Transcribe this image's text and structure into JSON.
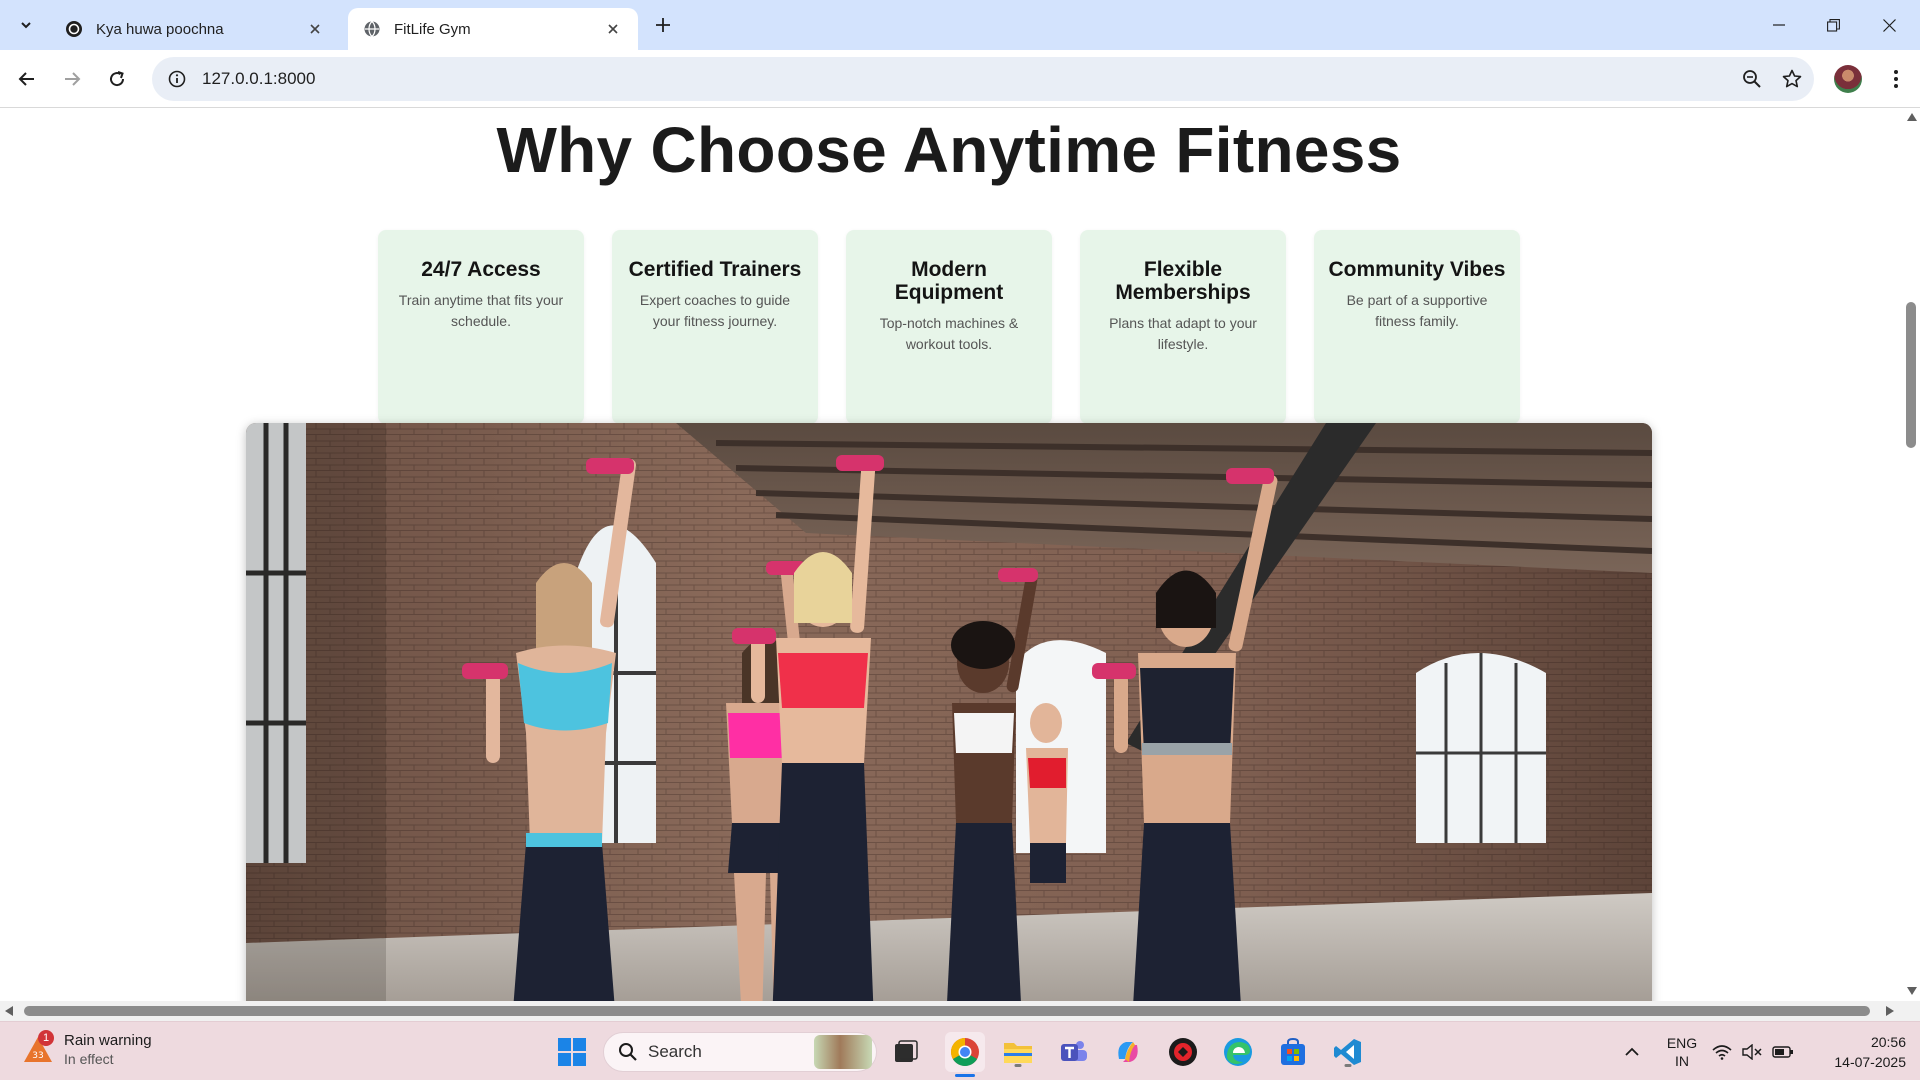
{
  "browser": {
    "tabs": [
      {
        "title": "Kya huwa poochna",
        "active": false,
        "icon": "chatgpt-icon"
      },
      {
        "title": "FitLife Gym",
        "active": true,
        "icon": "globe-icon"
      }
    ],
    "url": "127.0.0.1:8000"
  },
  "page": {
    "headline": "Why Choose Anytime Fitness",
    "features": [
      {
        "title": "24/7 Access",
        "desc": "Train anytime that fits your schedule."
      },
      {
        "title": "Certified Trainers",
        "desc": "Expert coaches to guide your fitness journey."
      },
      {
        "title": "Modern Equipment",
        "desc": "Top-notch machines & workout tools."
      },
      {
        "title": "Flexible Memberships",
        "desc": "Plans that adapt to your lifestyle."
      },
      {
        "title": "Community Vibes",
        "desc": "Be part of a supportive fitness family."
      }
    ]
  },
  "taskbar": {
    "weather": {
      "title": "Rain warning",
      "subtitle": "In effect",
      "badge": "1"
    },
    "search_placeholder": "Search",
    "language": {
      "line1": "ENG",
      "line2": "IN"
    },
    "time": "20:56",
    "date": "14-07-2025"
  },
  "colors": {
    "tabbar": "#d3e3fd",
    "card": "#e7f5e9",
    "taskbar": "#eedadf",
    "accent": "#1a73e8"
  }
}
